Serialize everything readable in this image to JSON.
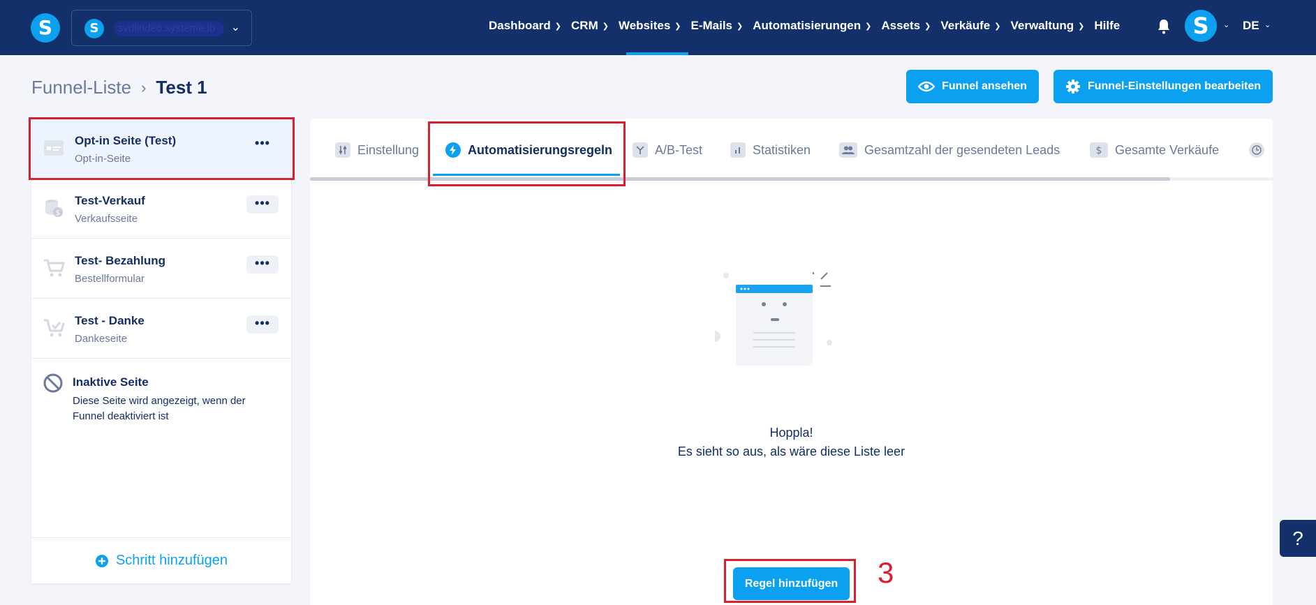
{
  "topbar": {
    "logo_letter": "S",
    "domain": "svdlinde6.systeme.io",
    "nav": [
      "Dashboard",
      "CRM",
      "Websites",
      "E-Mails",
      "Automatisierungen",
      "Assets",
      "Verkäufe",
      "Verwaltung"
    ],
    "help_label": "Hilfe",
    "avatar_letter": "S",
    "lang": "DE",
    "active_nav": "Websites",
    "colors": {
      "bar": "#13306a",
      "accent": "#0ca1f0"
    }
  },
  "breadcrumb": {
    "parent": "Funnel-Liste",
    "current": "Test 1"
  },
  "actions": {
    "view": "Funnel ansehen",
    "settings": "Funnel-Einstellungen bearbeiten"
  },
  "steps": [
    {
      "title": "Opt-in Seite (Test)",
      "subtitle": "Opt-in-Seite",
      "icon": "optin-page-icon",
      "active": true
    },
    {
      "title": "Test-Verkauf",
      "subtitle": "Verkaufsseite",
      "icon": "coins-icon"
    },
    {
      "title": "Test- Bezahlung",
      "subtitle": "Bestellformular",
      "icon": "cart-icon"
    },
    {
      "title": "Test - Danke",
      "subtitle": "Dankeseite",
      "icon": "cart-check-icon"
    }
  ],
  "more_label": "•••",
  "inactive": {
    "title": "Inaktive Seite",
    "description": "Diese Seite wird angezeigt, wenn der Funnel deaktiviert ist"
  },
  "add_step": "Schritt hinzufügen",
  "tabs": [
    "Einstellung",
    "Automatisierungsregeln",
    "A/B-Test",
    "Statistiken",
    "Gesamtzahl der gesendeten Leads",
    "Gesamte Verkäufe"
  ],
  "active_tab": "Automatisierungsregeln",
  "empty": {
    "title": "Hoppla!",
    "subtitle": "Es sieht so aus, als wäre diese Liste leer"
  },
  "add_rule": "Regel hinzufügen",
  "annotation": "3",
  "help_button": "?"
}
